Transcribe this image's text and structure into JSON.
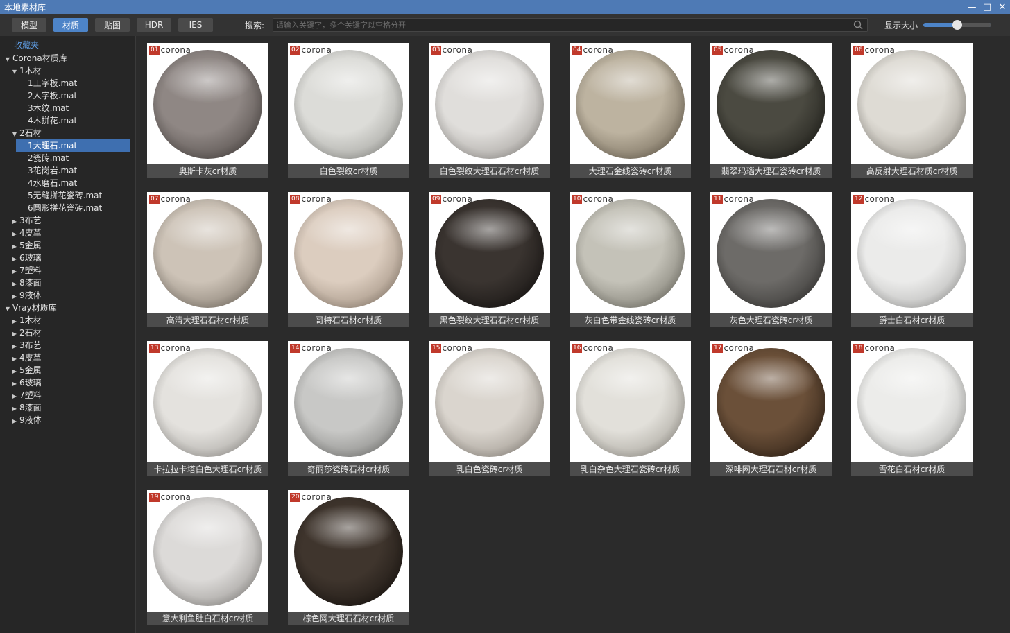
{
  "window": {
    "title": "本地素材库"
  },
  "toolbar": {
    "tabs": [
      {
        "label": "模型",
        "active": false
      },
      {
        "label": "材质",
        "active": true
      },
      {
        "label": "贴图",
        "active": false
      },
      {
        "label": "HDR",
        "active": false
      },
      {
        "label": "IES",
        "active": false
      }
    ],
    "search_label": "搜索:",
    "search_placeholder": "请输入关键字，多个关键字以空格分开",
    "size_label": "显示大小",
    "size_value": 0.5
  },
  "sidebar": {
    "favorites": "收藏夹",
    "tree": [
      {
        "label": "Corona材质库",
        "depth": 0,
        "expanded": true
      },
      {
        "label": "1木材",
        "depth": 1,
        "expanded": true
      },
      {
        "label": "1工字板.mat",
        "depth": 2
      },
      {
        "label": "2人字板.mat",
        "depth": 2
      },
      {
        "label": "3木纹.mat",
        "depth": 2
      },
      {
        "label": "4木拼花.mat",
        "depth": 2
      },
      {
        "label": "2石材",
        "depth": 1,
        "expanded": true
      },
      {
        "label": "1大理石.mat",
        "depth": 2,
        "selected": true
      },
      {
        "label": "2瓷砖.mat",
        "depth": 2
      },
      {
        "label": "3花岗岩.mat",
        "depth": 2
      },
      {
        "label": "4水磨石.mat",
        "depth": 2
      },
      {
        "label": "5无缝拼花瓷砖.mat",
        "depth": 2
      },
      {
        "label": "6圆形拼花瓷砖.mat",
        "depth": 2
      },
      {
        "label": "3布艺",
        "depth": 1,
        "expanded": false
      },
      {
        "label": "4皮革",
        "depth": 1,
        "expanded": false
      },
      {
        "label": "5金属",
        "depth": 1,
        "expanded": false
      },
      {
        "label": "6玻璃",
        "depth": 1,
        "expanded": false
      },
      {
        "label": "7塑料",
        "depth": 1,
        "expanded": false
      },
      {
        "label": "8漆面",
        "depth": 1,
        "expanded": false
      },
      {
        "label": "9液体",
        "depth": 1,
        "expanded": false
      },
      {
        "label": "Vray材质库",
        "depth": 0,
        "expanded": true
      },
      {
        "label": "1木材",
        "depth": 1,
        "expanded": false
      },
      {
        "label": "2石材",
        "depth": 1,
        "expanded": false
      },
      {
        "label": "3布艺",
        "depth": 1,
        "expanded": false
      },
      {
        "label": "4皮革",
        "depth": 1,
        "expanded": false
      },
      {
        "label": "5金属",
        "depth": 1,
        "expanded": false
      },
      {
        "label": "6玻璃",
        "depth": 1,
        "expanded": false
      },
      {
        "label": "7塑料",
        "depth": 1,
        "expanded": false
      },
      {
        "label": "8漆面",
        "depth": 1,
        "expanded": false
      },
      {
        "label": "9液体",
        "depth": 1,
        "expanded": false
      }
    ]
  },
  "materials": [
    {
      "num": "01",
      "brand": "corona",
      "name": "奥斯卡灰cr材质",
      "color": "#8f8784",
      "shade": "#3f3936"
    },
    {
      "num": "02",
      "brand": "corona",
      "name": "白色裂纹cr材质",
      "color": "#dcdcd8",
      "shade": "#8e8e89"
    },
    {
      "num": "03",
      "brand": "corona",
      "name": "白色裂纹大理石石材cr材质",
      "color": "#e0dedb",
      "shade": "#908c87"
    },
    {
      "num": "04",
      "brand": "corona",
      "name": "大理石金线瓷砖cr材质",
      "color": "#bdb3a0",
      "shade": "#5e5444"
    },
    {
      "num": "05",
      "brand": "corona",
      "name": "翡翠玛瑙大理石瓷砖cr材质",
      "color": "#4b4a41",
      "shade": "#141410"
    },
    {
      "num": "06",
      "brand": "corona",
      "name": "高反射大理石材质cr材质",
      "color": "#dedbd4",
      "shade": "#8c877e"
    },
    {
      "num": "07",
      "brand": "corona",
      "name": "高清大理石石材cr材质",
      "color": "#cdc3b7",
      "shade": "#6f665b"
    },
    {
      "num": "08",
      "brand": "corona",
      "name": "哥特石石材cr材质",
      "color": "#dccdbf",
      "shade": "#8a7a6a"
    },
    {
      "num": "09",
      "brand": "corona",
      "name": "黑色裂纹大理石石材cr材质",
      "color": "#3a3430",
      "shade": "#0e0c0b"
    },
    {
      "num": "10",
      "brand": "corona",
      "name": "灰白色带金线瓷砖cr材质",
      "color": "#c4c2b8",
      "shade": "#66645a"
    },
    {
      "num": "11",
      "brand": "corona",
      "name": "灰色大理石瓷砖cr材质",
      "color": "#6d6b68",
      "shade": "#2a2927"
    },
    {
      "num": "12",
      "brand": "corona",
      "name": "爵士白石材cr材质",
      "color": "#ebebea",
      "shade": "#a3a3a1"
    },
    {
      "num": "13",
      "brand": "corona",
      "name": "卡拉拉卡塔白色大理石cr材质",
      "color": "#e4e2de",
      "shade": "#95928d"
    },
    {
      "num": "14",
      "brand": "corona",
      "name": "奇丽莎瓷砖石材cr材质",
      "color": "#c8c8c6",
      "shade": "#6f6f6c"
    },
    {
      "num": "15",
      "brand": "corona",
      "name": "乳白色瓷砖cr材质",
      "color": "#dad5ce",
      "shade": "#8b847b"
    },
    {
      "num": "16",
      "brand": "corona",
      "name": "乳白杂色大理石瓷砖cr材质",
      "color": "#e2e0da",
      "shade": "#938f86"
    },
    {
      "num": "17",
      "brand": "corona",
      "name": "深啡网大理石石材cr材质",
      "color": "#6b5039",
      "shade": "#22170e"
    },
    {
      "num": "18",
      "brand": "corona",
      "name": "雪花白石材cr材质",
      "color": "#ececea",
      "shade": "#a4a4a1"
    },
    {
      "num": "19",
      "brand": "corona",
      "name": "意大利鱼肚白石材cr材质",
      "color": "#dcdad8",
      "shade": "#86837f"
    },
    {
      "num": "20",
      "brand": "corona",
      "name": "棕色网大理石石材cr材质",
      "color": "#3f352d",
      "shade": "#110d0a"
    }
  ]
}
